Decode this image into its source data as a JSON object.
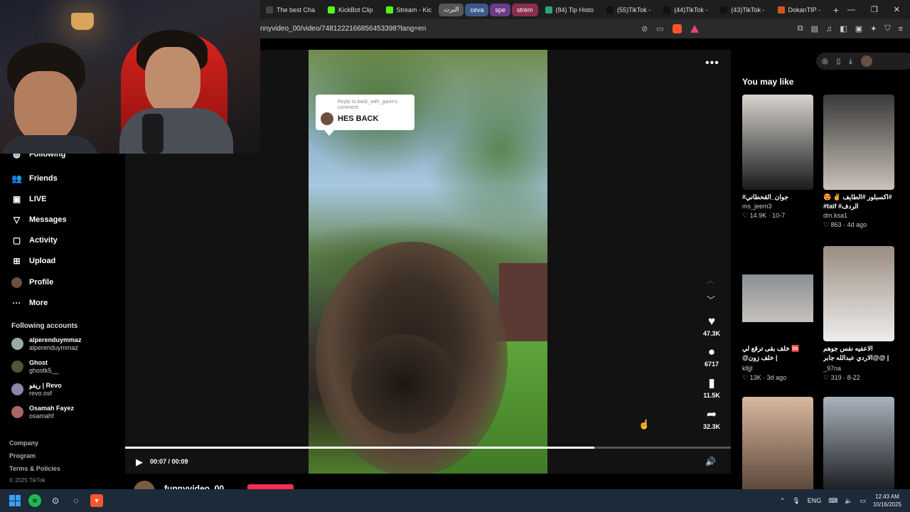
{
  "browser": {
    "tabs": [
      {
        "label": "The best Cha",
        "color": "#444"
      },
      {
        "label": "KickBot Clip",
        "color": "#53fc18"
      },
      {
        "label": "Stream - Kic",
        "color": "#53fc18"
      }
    ],
    "groups": [
      {
        "label": "البرت",
        "color": "#555"
      },
      {
        "label": "ceva",
        "color": "#3b5a8a"
      },
      {
        "label": "spe",
        "color": "#6a3b8a"
      },
      {
        "label": "strem",
        "color": "#8a2d4f"
      }
    ],
    "tabs_right": [
      {
        "label": "(84) Tip Histo",
        "color": "#2aa876"
      },
      {
        "label": "(55)TikTok -",
        "color": "#111"
      },
      {
        "label": "(44)TikTok -",
        "color": "#111"
      },
      {
        "label": "(43)TikTok -",
        "color": "#111"
      },
      {
        "label": "DokanTIP -",
        "color": "#d4561e"
      }
    ],
    "new_tab": "+",
    "url": "nnyvideo_00/video/7481222166856453398?lang=en"
  },
  "sidebar": {
    "partial_top": "Following",
    "items": [
      {
        "label": "Friends",
        "icon": "users-icon",
        "glyph": "👥"
      },
      {
        "label": "LIVE",
        "icon": "live-icon",
        "glyph": "▣"
      },
      {
        "label": "Messages",
        "icon": "messages-icon",
        "glyph": "▽"
      },
      {
        "label": "Activity",
        "icon": "activity-icon",
        "glyph": "▢"
      },
      {
        "label": "Upload",
        "icon": "upload-icon",
        "glyph": "⊞"
      },
      {
        "label": "Profile",
        "icon": "profile-icon",
        "glyph": "●"
      },
      {
        "label": "More",
        "icon": "more-icon",
        "glyph": "···"
      }
    ],
    "following_heading": "Following accounts",
    "accounts": [
      {
        "name": "alperenduymmaz",
        "handle": "alperenduymmaz"
      },
      {
        "name": "Ghost",
        "handle": "ghostk5__"
      },
      {
        "name": "ريفو | Revo",
        "handle": "revo.osf"
      },
      {
        "name": "Osamah Fayez",
        "handle": "osamahf"
      }
    ],
    "footer_links": [
      "Company",
      "Program",
      "Terms & Policies"
    ],
    "copyright": "© 2025 TikTok"
  },
  "video": {
    "reply_small": "Reply to back_with_gavin's comment",
    "reply_big": "HES BACK",
    "more": "•••",
    "progress": 0.775,
    "time": "00:07 / 00:09",
    "actions": [
      {
        "icon": "heart-icon",
        "glyph": "♥",
        "count": "47.3K"
      },
      {
        "icon": "comment-icon",
        "glyph": "●",
        "count": "6717"
      },
      {
        "icon": "bookmark-icon",
        "glyph": "▮",
        "count": "11.5K"
      },
      {
        "icon": "share-icon",
        "glyph": "➦",
        "count": "32.3K"
      }
    ],
    "author": "funnyvideo_00"
  },
  "right": {
    "heading": "You may like",
    "cards": [
      {
        "caption": "#جوان_القحطاني",
        "author": "ms_jeem3",
        "likes": "14.9K",
        "date": "10-7",
        "bg": "linear-gradient(180deg,#d8d4cf,#1a1a1a)"
      },
      {
        "caption": "😍 ✌️ اكسبلور #الطايف# #taif #الردف",
        "author": "dm.ksa1",
        "likes": "863",
        "date": "4d ago",
        "bg": "linear-gradient(180deg,#3a3a3a,#c9c2b8)"
      },
      {
        "caption": "خلف بقى ترقع لي 🆘 @خلف زون | KhalafZone...",
        "author": "klljjl",
        "likes": "13K",
        "date": "3d ago",
        "bg": "linear-gradient(180deg,#000 30%,#8a8f94 30%,#c7c2bb 80%,#000 80%)"
      },
      {
        "caption": "الاعفيه نفس جوهم @الاردي عبدالله جابر@ | AJ #fy...",
        "author": "_97na",
        "likes": "319",
        "date": "8-22",
        "bg": "linear-gradient(180deg,#9a8c80,#eeeeee)"
      },
      {
        "caption": "",
        "author": "",
        "likes": "",
        "date": "",
        "bg": "linear-gradient(180deg,#d8b8a0,#5a4538)"
      },
      {
        "caption": "",
        "author": "",
        "likes": "",
        "date": "",
        "bg": "linear-gradient(180deg,#a9b3bd,#1b1b1f)"
      }
    ]
  },
  "taskbar": {
    "lang": "ENG",
    "time": "12:43 AM",
    "date": "10/16/2025"
  }
}
